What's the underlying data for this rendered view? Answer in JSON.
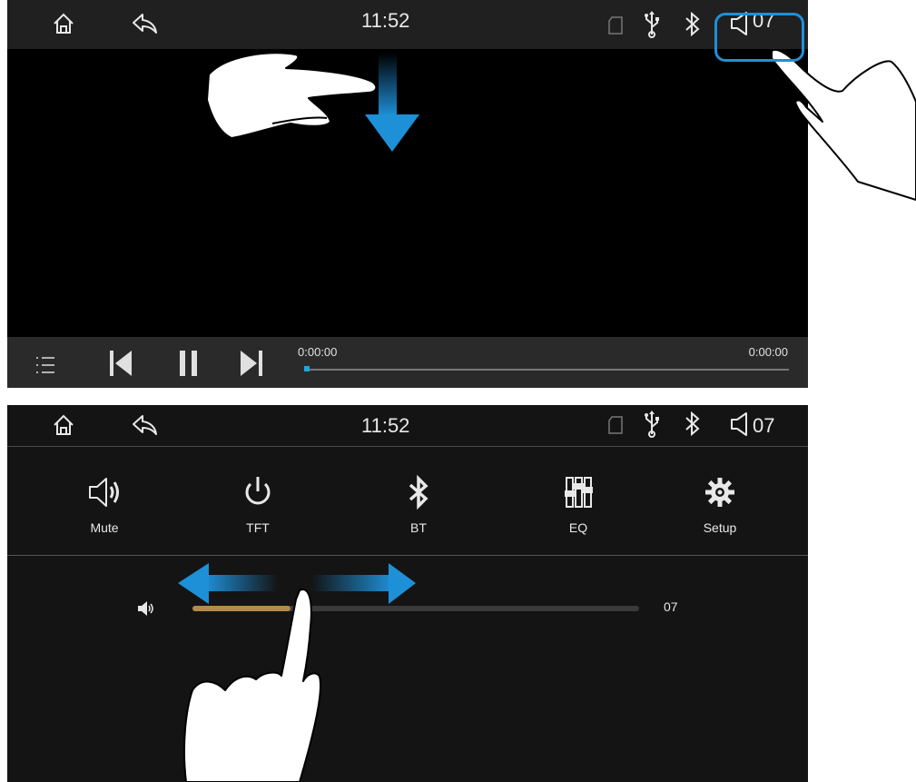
{
  "screen1": {
    "status_bar": {
      "clock": "11:52",
      "volume": "07",
      "icons": [
        "home-icon",
        "back-icon",
        "sd-card-icon",
        "usb-icon",
        "bluetooth-icon",
        "speaker-icon"
      ]
    },
    "player": {
      "time_elapsed": "0:00:00",
      "time_total": "0:00:00",
      "progress": 0.0,
      "controls": [
        "playlist-icon",
        "previous-icon",
        "pause-icon",
        "next-icon"
      ]
    }
  },
  "screen2": {
    "status_bar": {
      "clock": "11:52",
      "volume": "07"
    },
    "quick_menu": [
      {
        "label": "Mute",
        "icon": "speaker-icon"
      },
      {
        "label": "TFT",
        "icon": "power-icon"
      },
      {
        "label": "BT",
        "icon": "bluetooth-icon"
      },
      {
        "label": "EQ",
        "icon": "equalizer-icon"
      },
      {
        "label": "Setup",
        "icon": "gear-icon"
      }
    ],
    "volume_slider": {
      "value_label": "07",
      "level": 0.22
    }
  },
  "colors": {
    "accent_blue": "#1e90d8",
    "slider_fill": "#b58a4a"
  }
}
